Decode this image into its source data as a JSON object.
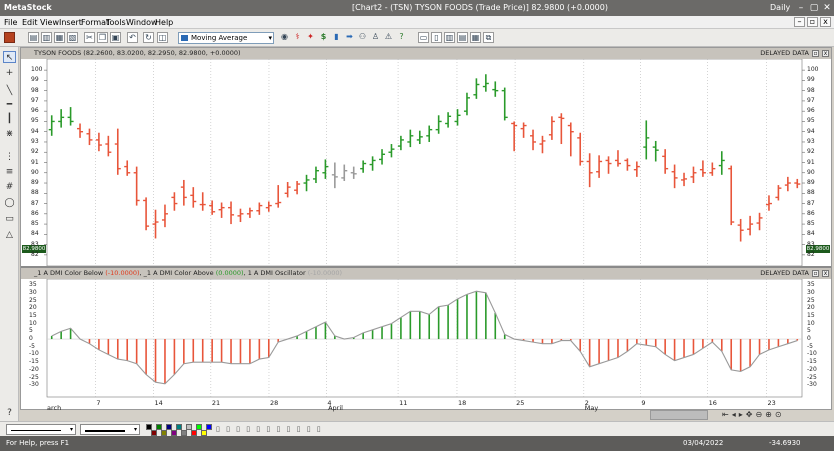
{
  "window": {
    "app_title": "MetaStock",
    "doc_title": "[Chart2 - (TSN) TYSON FOODS (Trade Price)]  82.9800 (+0.0000)",
    "mode": "Daily",
    "controls": [
      "–",
      "▢",
      "✕"
    ]
  },
  "menu": {
    "items": [
      "File",
      "Edit",
      "View",
      "Insert",
      "Format",
      "Tools",
      "Window",
      "Help"
    ],
    "window_controls": [
      "–",
      "▫",
      "x"
    ]
  },
  "toolbar": {
    "indicator_select": "Moving Average"
  },
  "price_panel": {
    "title": "TYSON FOODS (82.2600, 83.0200, 82.2950, 82.9800, +0.0000)",
    "delayed_label": "DELAYED DATA",
    "current_price": "82.9800",
    "y_ticks": [
      "100",
      "99",
      "98",
      "97",
      "96",
      "95",
      "94",
      "93",
      "92",
      "91",
      "90",
      "89",
      "88",
      "87",
      "86",
      "85",
      "84",
      "83",
      "82"
    ]
  },
  "indicator_panel": {
    "title_prefix": "_1 A DMI Color Below",
    "below_value": "(-10.0000)",
    "sep1": ", _1 A DMI Color Above",
    "above_value": "(0.0000)",
    "sep2": ", 1  A  DMI  Oscillator",
    "osc_value": "(-10.0000)",
    "delayed_label": "DELAYED DATA",
    "y_ticks": [
      "35",
      "30",
      "25",
      "20",
      "15",
      "10",
      "5",
      "0",
      "-5",
      "-10",
      "-15",
      "-20",
      "-25",
      "-30"
    ]
  },
  "date_axis": {
    "labels": [
      {
        "text": "arch",
        "pos": 0.0
      },
      {
        "text": "7",
        "pos": 0.064
      },
      {
        "text": "14",
        "pos": 0.141
      },
      {
        "text": "21",
        "pos": 0.217
      },
      {
        "text": "28",
        "pos": 0.294
      },
      {
        "text": "4",
        "pos": 0.37
      },
      {
        "text": "April",
        "pos": 0.371
      },
      {
        "text": "11",
        "pos": 0.465
      },
      {
        "text": "18",
        "pos": 0.543
      },
      {
        "text": "25",
        "pos": 0.62
      },
      {
        "text": "2",
        "pos": 0.711
      },
      {
        "text": "May",
        "pos": 0.711
      },
      {
        "text": "9",
        "pos": 0.786
      },
      {
        "text": "16",
        "pos": 0.875
      },
      {
        "text": "23",
        "pos": 0.953
      }
    ]
  },
  "status": {
    "help": "For Help, press F1",
    "date": "03/04/2022",
    "value": "-34.6930"
  },
  "colors": {
    "up": "#2a9a2a",
    "down": "#e8553a",
    "neutral": "#9a9a9a",
    "osc_line": "#9a9a9a"
  },
  "chart_data": {
    "type": "bar",
    "title": "TYSON FOODS",
    "price_ylim": [
      81.5,
      100.5
    ],
    "osc_ylim": [
      -35,
      37
    ],
    "series": [
      {
        "name": "price",
        "ohlc": [
          [
            94.2,
            95.6,
            93.6,
            95.0,
            "up"
          ],
          [
            95.0,
            96.2,
            94.4,
            95.4,
            "up"
          ],
          [
            95.4,
            96.4,
            94.6,
            95.0,
            "up"
          ],
          [
            94.3,
            94.8,
            93.4,
            94.0,
            "down"
          ],
          [
            93.8,
            94.3,
            92.7,
            93.2,
            "down"
          ],
          [
            93.2,
            93.9,
            92.1,
            92.7,
            "down"
          ],
          [
            92.8,
            93.6,
            91.6,
            92.0,
            "down"
          ],
          [
            92.8,
            94.3,
            89.8,
            90.4,
            "down"
          ],
          [
            90.6,
            91.2,
            89.7,
            90.0,
            "down"
          ],
          [
            90.0,
            90.6,
            86.8,
            87.3,
            "down"
          ],
          [
            87.3,
            87.6,
            84.4,
            84.8,
            "down"
          ],
          [
            85.0,
            86.4,
            83.6,
            85.2,
            "down"
          ],
          [
            85.4,
            86.9,
            84.7,
            86.0,
            "down"
          ],
          [
            87.6,
            88.1,
            86.3,
            87.0,
            "down"
          ],
          [
            88.6,
            89.3,
            86.8,
            87.6,
            "down"
          ],
          [
            87.8,
            88.6,
            86.6,
            87.2,
            "down"
          ],
          [
            86.9,
            88.1,
            86.3,
            86.9,
            "down"
          ],
          [
            86.8,
            87.3,
            85.9,
            86.2,
            "down"
          ],
          [
            86.4,
            87.1,
            85.6,
            86.6,
            "down"
          ],
          [
            86.6,
            87.2,
            85.0,
            85.9,
            "down"
          ],
          [
            85.8,
            86.5,
            85.2,
            86.0,
            "down"
          ],
          [
            86.0,
            86.6,
            85.6,
            86.3,
            "down"
          ],
          [
            86.3,
            87.1,
            85.9,
            86.8,
            "down"
          ],
          [
            86.6,
            87.2,
            86.2,
            86.8,
            "down"
          ],
          [
            87.0,
            88.8,
            86.6,
            87.1,
            "down"
          ],
          [
            88.0,
            89.1,
            87.6,
            88.6,
            "down"
          ],
          [
            88.3,
            89.2,
            87.9,
            88.9,
            "down"
          ],
          [
            89.0,
            89.8,
            88.2,
            89.3,
            "up"
          ],
          [
            89.4,
            90.6,
            89.0,
            90.2,
            "up"
          ],
          [
            90.0,
            91.3,
            89.4,
            90.6,
            "up"
          ],
          [
            89.8,
            91.0,
            88.5,
            89.6,
            "neutral"
          ],
          [
            89.5,
            90.8,
            89.2,
            90.2,
            "neutral"
          ],
          [
            90.0,
            90.6,
            89.4,
            89.9,
            "neutral"
          ],
          [
            90.4,
            91.2,
            90.0,
            90.9,
            "up"
          ],
          [
            90.8,
            91.6,
            90.2,
            91.2,
            "up"
          ],
          [
            91.3,
            92.3,
            90.8,
            91.8,
            "up"
          ],
          [
            92.0,
            92.8,
            91.5,
            92.3,
            "up"
          ],
          [
            92.6,
            93.6,
            92.2,
            93.2,
            "up"
          ],
          [
            93.0,
            94.2,
            92.5,
            93.6,
            "up"
          ],
          [
            93.2,
            94.1,
            92.8,
            93.5,
            "up"
          ],
          [
            93.6,
            94.6,
            93.0,
            94.2,
            "up"
          ],
          [
            94.2,
            95.6,
            93.8,
            95.0,
            "up"
          ],
          [
            94.8,
            95.9,
            94.4,
            95.5,
            "up"
          ],
          [
            95.0,
            96.2,
            94.6,
            95.6,
            "up"
          ],
          [
            96.0,
            97.8,
            95.6,
            97.3,
            "up"
          ],
          [
            97.6,
            99.2,
            97.2,
            98.6,
            "up"
          ],
          [
            98.4,
            99.6,
            97.9,
            98.7,
            "up"
          ],
          [
            98.1,
            98.9,
            97.4,
            98.0,
            "up"
          ],
          [
            98.0,
            98.3,
            95.1,
            95.4,
            "up"
          ],
          [
            94.8,
            95.0,
            92.1,
            94.6,
            "down"
          ],
          [
            94.3,
            94.9,
            93.4,
            94.6,
            "down"
          ],
          [
            93.6,
            94.2,
            92.2,
            93.0,
            "down"
          ],
          [
            92.8,
            93.6,
            91.9,
            93.1,
            "down"
          ],
          [
            93.7,
            95.5,
            93.2,
            95.0,
            "down"
          ],
          [
            95.4,
            95.8,
            92.8,
            95.3,
            "down"
          ],
          [
            94.6,
            94.9,
            91.6,
            94.0,
            "down"
          ],
          [
            93.4,
            93.9,
            90.7,
            91.1,
            "down"
          ],
          [
            91.1,
            91.9,
            88.6,
            90.0,
            "down"
          ],
          [
            90.1,
            91.7,
            89.5,
            91.1,
            "down"
          ],
          [
            91.2,
            91.6,
            89.9,
            90.9,
            "down"
          ],
          [
            91.2,
            92.2,
            90.6,
            90.9,
            "down"
          ],
          [
            91.2,
            91.4,
            90.2,
            90.7,
            "down"
          ],
          [
            90.3,
            91.1,
            89.6,
            90.6,
            "down"
          ],
          [
            92.5,
            95.1,
            91.3,
            93.4,
            "up"
          ],
          [
            92.5,
            93.1,
            91.1,
            92.2,
            "up"
          ],
          [
            91.6,
            92.3,
            89.9,
            90.4,
            "down"
          ],
          [
            90.1,
            90.8,
            88.5,
            89.5,
            "down"
          ],
          [
            89.3,
            90.0,
            88.7,
            89.4,
            "down"
          ],
          [
            89.6,
            90.6,
            89.0,
            90.0,
            "down"
          ],
          [
            90.3,
            91.2,
            89.6,
            90.0,
            "down"
          ],
          [
            90.0,
            91.0,
            89.7,
            90.4,
            "down"
          ],
          [
            90.7,
            92.1,
            89.8,
            91.2,
            "up"
          ],
          [
            90.4,
            90.7,
            84.9,
            85.2,
            "down"
          ],
          [
            84.9,
            85.5,
            83.3,
            84.4,
            "down"
          ],
          [
            84.5,
            85.8,
            83.9,
            85.0,
            "down"
          ],
          [
            85.1,
            86.1,
            84.4,
            85.6,
            "down"
          ],
          [
            86.9,
            87.8,
            86.3,
            87.0,
            "down"
          ],
          [
            87.6,
            88.8,
            87.3,
            88.5,
            "down"
          ],
          [
            88.8,
            89.6,
            88.2,
            89.0,
            "down"
          ],
          [
            89.0,
            89.4,
            88.5,
            88.9,
            "down"
          ]
        ]
      },
      {
        "name": "oscillator",
        "values": [
          2,
          5,
          7,
          0,
          -3,
          -7,
          -10,
          -13,
          -14,
          -16,
          -23,
          -28,
          -29,
          -23,
          -16,
          -15,
          -15,
          -15,
          -15,
          -16,
          -16,
          -16,
          -13,
          -12,
          -2,
          0,
          2,
          5,
          8,
          11,
          2,
          0,
          1,
          4,
          6,
          8,
          10,
          14,
          18,
          18,
          16,
          21,
          22,
          26,
          29,
          31,
          30,
          17,
          3,
          0,
          -1,
          -2,
          -3,
          -3,
          -1,
          -1,
          -8,
          -18,
          -16,
          -14,
          -12,
          -8,
          -3,
          -4,
          -5,
          -10,
          -14,
          -12,
          -10,
          -6,
          -2,
          -8,
          -20,
          -21,
          -18,
          -10,
          -7,
          -5,
          -3,
          -1
        ]
      }
    ]
  }
}
